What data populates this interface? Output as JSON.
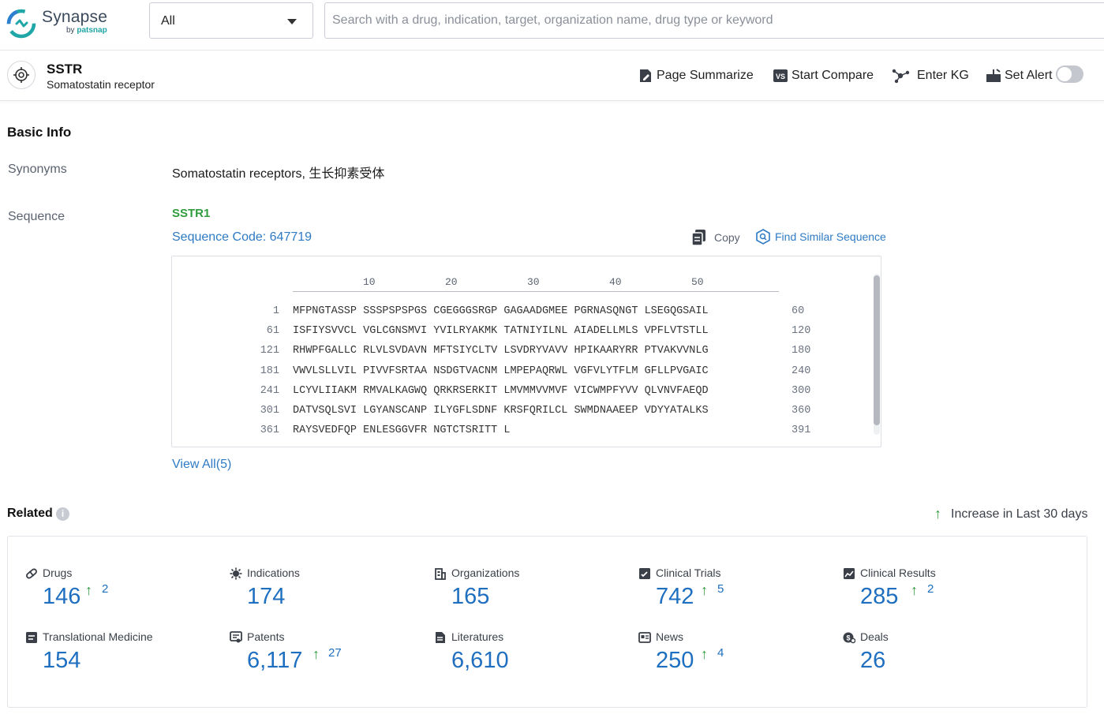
{
  "header": {
    "logo_name": "Synapse",
    "logo_sub_by": "by",
    "logo_sub_brand": "patsnap",
    "search_scope": "All",
    "search_placeholder": "Search with a drug, indication, target, organization name, drug type or keyword"
  },
  "target": {
    "title": "SSTR",
    "subtitle": "Somatostatin receptor"
  },
  "toolbar": {
    "page_summarize": "Page Summarize",
    "start_compare": "Start Compare",
    "enter_kg": "Enter KG",
    "set_alert": "Set Alert",
    "set_alert_on": false
  },
  "basic_info": {
    "title": "Basic Info",
    "synonyms_label": "Synonyms",
    "synonyms_value": "Somatostatin receptors, 生长抑素受体",
    "sequence_label": "Sequence",
    "sequence_name": "SSTR1",
    "sequence_code": "Sequence Code: 647719",
    "copy_label": "Copy",
    "find_similar_label": "Find Similar Sequence",
    "ruler": [
      "10",
      "20",
      "30",
      "40",
      "50"
    ],
    "lines": [
      {
        "start": "1",
        "seq": "MFPNGTASSP SSSPSPSPGS CGEGGGSRGP GAGAADGMEE PGRNASQNGT LSEGQGSAIL",
        "end": "60"
      },
      {
        "start": "61",
        "seq": "ISFIYSVVCL VGLCGNSMVI YVILRYAKMK TATNIYILNL AIADELLMLS VPFLVTSTLL",
        "end": "120"
      },
      {
        "start": "121",
        "seq": "RHWPFGALLC RLVLSVDAVN MFTSIYCLTV LSVDRYVAVV HPIKAARYRR PTVAKVVNLG",
        "end": "180"
      },
      {
        "start": "181",
        "seq": "VWVLSLLVIL PIVVFSRTAA NSDGTVACNM LMPEPAQRWL VGFVLYTFLM GFLLPVGAIC",
        "end": "240"
      },
      {
        "start": "241",
        "seq": "LCYVLIIAKM RMVALKAGWQ QRKRSERKIT LMVMMVVMVF VICWMPFYVV QLVNVFAEQD",
        "end": "300"
      },
      {
        "start": "301",
        "seq": "DATVSQLSVI LGYANSCANP ILYGFLSDNF KRSFQRILCL SWMDNAAEEP VDYYATALKS",
        "end": "360"
      },
      {
        "start": "361",
        "seq": "RAYSVEDFQP ENLESGGVFR NGTCTSRITT L",
        "end": "391"
      }
    ],
    "view_all": "View All(5)"
  },
  "related": {
    "title": "Related",
    "info_glyph": "i",
    "legend_arrow": "↑",
    "legend": "Increase in Last 30 days",
    "stats": [
      {
        "label": "Drugs",
        "value": "146",
        "increase": "2",
        "icon": "pill-icon"
      },
      {
        "label": "Indications",
        "value": "174",
        "increase": "",
        "icon": "virus-icon"
      },
      {
        "label": "Organizations",
        "value": "165",
        "increase": "",
        "icon": "building-icon"
      },
      {
        "label": "Clinical Trials",
        "value": "742",
        "increase": "5",
        "icon": "clipboard-icon"
      },
      {
        "label": "Clinical Results",
        "value": "285",
        "increase": "2",
        "icon": "chart-doc-icon"
      },
      {
        "label": "Translational Medicine",
        "value": "154",
        "increase": "",
        "icon": "report-icon"
      },
      {
        "label": "Patents",
        "value": "6,117",
        "increase": "27",
        "icon": "patent-icon"
      },
      {
        "label": "Literatures",
        "value": "6,610",
        "increase": "",
        "icon": "literature-icon"
      },
      {
        "label": "News",
        "value": "250",
        "increase": "4",
        "icon": "news-icon"
      },
      {
        "label": "Deals",
        "value": "26",
        "increase": "",
        "icon": "deals-icon"
      }
    ]
  },
  "colors": {
    "accent_blue": "#2e7bc4",
    "number_blue": "#1f6fc0",
    "increase_green": "#2f9c3d",
    "logo_teal": "#20a5a5"
  }
}
